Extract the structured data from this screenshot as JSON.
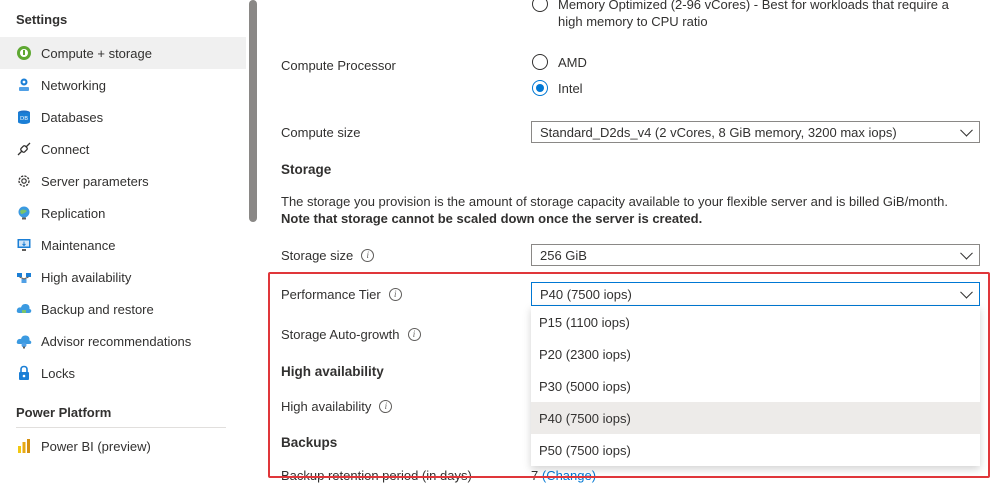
{
  "sidebar": {
    "settings_header": "Settings",
    "items": [
      {
        "label": "Compute + storage",
        "icon": "compute-storage-icon",
        "selected": true
      },
      {
        "label": "Networking",
        "icon": "networking-icon"
      },
      {
        "label": "Databases",
        "icon": "databases-icon"
      },
      {
        "label": "Connect",
        "icon": "connect-icon"
      },
      {
        "label": "Server parameters",
        "icon": "server-parameters-icon"
      },
      {
        "label": "Replication",
        "icon": "replication-icon"
      },
      {
        "label": "Maintenance",
        "icon": "maintenance-icon"
      },
      {
        "label": "High availability",
        "icon": "high-availability-icon"
      },
      {
        "label": "Backup and restore",
        "icon": "backup-restore-icon"
      },
      {
        "label": "Advisor recommendations",
        "icon": "advisor-icon"
      },
      {
        "label": "Locks",
        "icon": "lock-icon"
      }
    ],
    "power_header": "Power Platform",
    "power_items": [
      {
        "label": "Power BI (preview)",
        "icon": "power-bi-icon"
      }
    ]
  },
  "compute": {
    "memory_option_line1": "Memory Optimized (2-96 vCores) - Best for workloads that require a",
    "memory_option_line2": "high memory to CPU ratio",
    "processor_label": "Compute Processor",
    "processor_options": [
      {
        "label": "AMD",
        "checked": false
      },
      {
        "label": "Intel",
        "checked": true
      }
    ],
    "size_label": "Compute size",
    "size_value": "Standard_D2ds_v4 (2 vCores, 8 GiB memory, 3200 max iops)"
  },
  "storage": {
    "title": "Storage",
    "desc_line1": "The storage you provision is the amount of storage capacity available to your flexible server and is billed GiB/month.",
    "desc_line2": "Note that storage cannot be scaled down once the server is created.",
    "size_label": "Storage size",
    "size_value": "256 GiB",
    "tier_label": "Performance Tier",
    "tier_value": "P40 (7500 iops)",
    "tier_options": [
      {
        "label": "P15 (1100 iops)",
        "selected": false
      },
      {
        "label": "P20 (2300 iops)",
        "selected": false
      },
      {
        "label": "P30 (5000 iops)",
        "selected": false
      },
      {
        "label": "P40 (7500 iops)",
        "selected": true
      },
      {
        "label": "P50 (7500 iops)",
        "selected": false
      }
    ],
    "autogrowth_label": "Storage Auto-growth"
  },
  "ha": {
    "title": "High availability",
    "label": "High availability"
  },
  "backups": {
    "title": "Backups",
    "retention_label_partial": "Backup retention period (in days)",
    "retention_value": "7",
    "change_link": "(Change)"
  },
  "colors": {
    "accent": "#0078d4",
    "highlight_border": "#e0363a",
    "selected_bg": "#f0f0f0"
  }
}
